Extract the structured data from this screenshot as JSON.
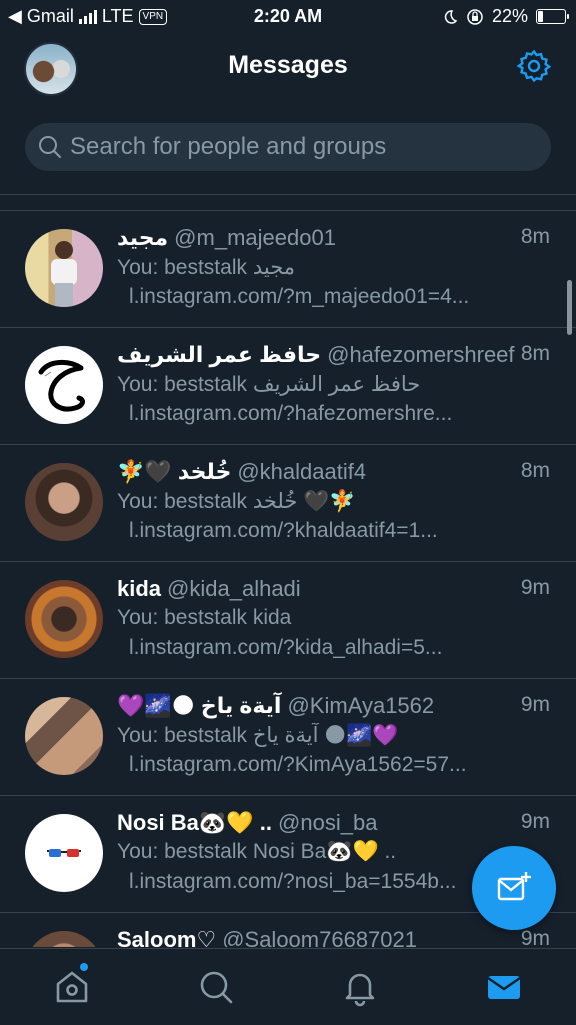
{
  "status_bar": {
    "back_app": "◀ Gmail",
    "network": "LTE",
    "vpn": "VPN",
    "time": "2:20 AM",
    "battery": "22%",
    "battery_level": 0.22
  },
  "header": {
    "title": "Messages"
  },
  "search": {
    "placeholder": "Search for people and groups"
  },
  "conversations": [
    {
      "name": "مجيد",
      "handle": "@m_majeedo01",
      "time": "8m",
      "preview": "You: beststalk مجيد",
      "link": "l.instagram.com/?m_majeedo01=4..."
    },
    {
      "name": "حافظ عمر الشريف",
      "handle": "@hafezomershreef",
      "time": "8m",
      "preview": "You: beststalk حافظ عمر الشريف",
      "link": "l.instagram.com/?hafezomershre..."
    },
    {
      "name": "🧚🖤 خُلخد",
      "handle": "@khaldaatif4",
      "time": "8m",
      "preview": "You: beststalk خُلخد 🖤🧚",
      "link": "l.instagram.com/?khaldaatif4=1..."
    },
    {
      "name": "kida",
      "handle": "@kida_alhadi",
      "time": "9m",
      "preview": "You: beststalk kida",
      "link": "l.instagram.com/?kida_alhadi=5..."
    },
    {
      "name": "💜🌌🌑 آيةة ياخ",
      "handle": "@KimAya1562",
      "time": "9m",
      "preview": "You: beststalk آيةة ياخ 🌑🌌💜",
      "link": "l.instagram.com/?KimAya1562=57..."
    },
    {
      "name": "Nosi Ba🐼💛 ..",
      "handle": "@nosi_ba",
      "time": "9m",
      "preview": "You: beststalk Nosi Ba🐼💛 ..",
      "link": "l.instagram.com/?nosi_ba=1554b..."
    },
    {
      "name": "Saloom♡",
      "handle": "@Saloom76687021",
      "time": "9m",
      "preview": "",
      "link": ""
    }
  ],
  "icons": {
    "settings": "gear-icon",
    "search": "search-icon",
    "compose": "new-message-icon",
    "tabs": [
      "home-icon",
      "search-icon",
      "bell-icon",
      "mail-icon"
    ]
  },
  "colors": {
    "background": "#15202b",
    "accent": "#1d9bf0",
    "secondary_text": "#8899a6",
    "divider": "#38444d"
  }
}
